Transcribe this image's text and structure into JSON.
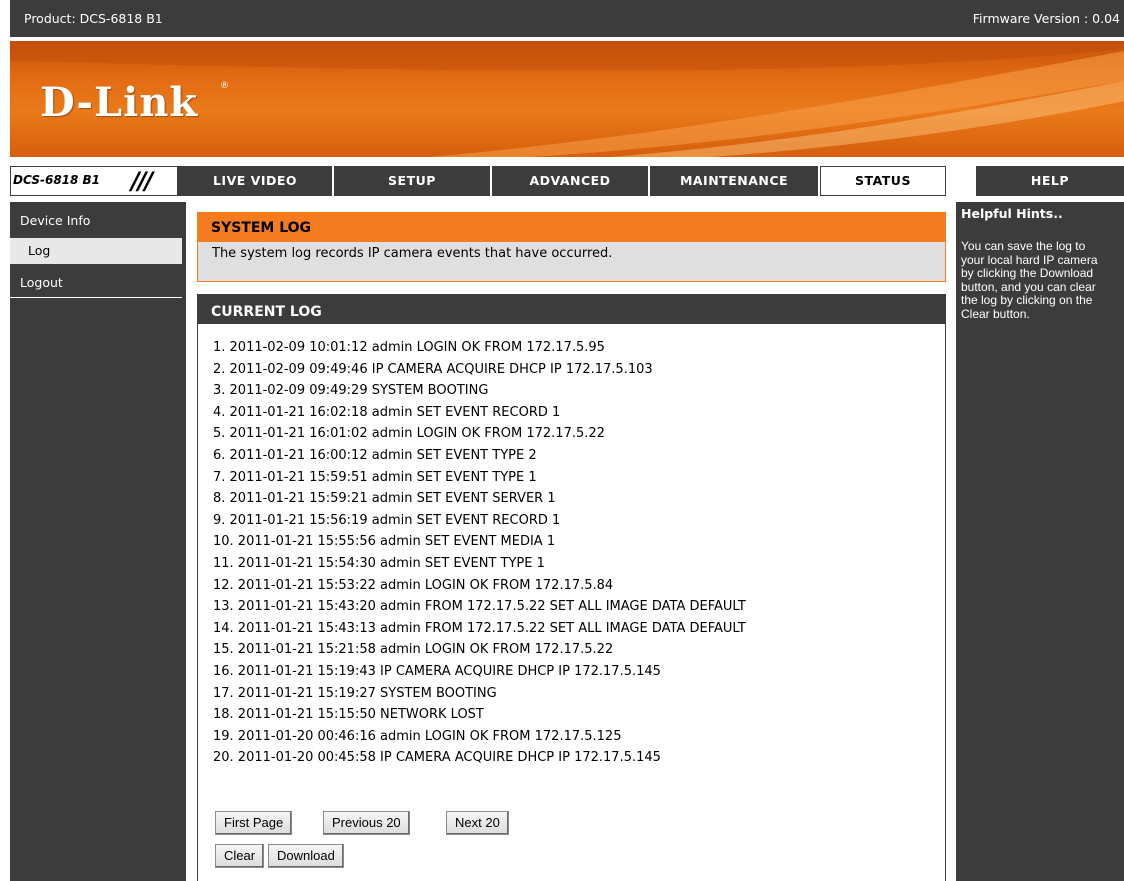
{
  "header": {
    "product": "Product: DCS-6818 B1",
    "firmware": "Firmware Version : 0.04"
  },
  "brand": {
    "logo_text": "D-Link",
    "registered_mark": "®",
    "accent_color": "#f47b20",
    "dark_color": "#3c3c3c"
  },
  "nav": {
    "model": "DCS-6818 B1",
    "slashes": "///",
    "tabs": [
      {
        "label": "LIVE VIDEO"
      },
      {
        "label": "SETUP"
      },
      {
        "label": "ADVANCED"
      },
      {
        "label": "MAINTENANCE"
      },
      {
        "label": "STATUS"
      },
      {
        "label": "HELP"
      }
    ],
    "active_tab": "STATUS"
  },
  "sidebar": {
    "items": [
      {
        "label": "Device Info"
      },
      {
        "label": "Log"
      },
      {
        "label": "Logout"
      }
    ],
    "active_item": "Log"
  },
  "system_log": {
    "title": "SYSTEM LOG",
    "description": "The system log records IP camera events that have occurred."
  },
  "current_log": {
    "title": "CURRENT LOG",
    "entries": [
      "1. 2011-02-09 10:01:12 admin LOGIN OK FROM 172.17.5.95",
      "2. 2011-02-09 09:49:46 IP CAMERA ACQUIRE DHCP IP 172.17.5.103",
      "3. 2011-02-09 09:49:29 SYSTEM BOOTING",
      "4. 2011-01-21 16:02:18 admin SET EVENT RECORD 1",
      "5. 2011-01-21 16:01:02 admin LOGIN OK FROM 172.17.5.22",
      "6. 2011-01-21 16:00:12 admin SET EVENT TYPE 2",
      "7. 2011-01-21 15:59:51 admin SET EVENT TYPE 1",
      "8. 2011-01-21 15:59:21 admin SET EVENT SERVER 1",
      "9. 2011-01-21 15:56:19 admin SET EVENT RECORD 1",
      "10. 2011-01-21 15:55:56 admin SET EVENT MEDIA 1",
      "11. 2011-01-21 15:54:30 admin SET EVENT TYPE 1",
      "12. 2011-01-21 15:53:22 admin LOGIN OK FROM 172.17.5.84",
      "13. 2011-01-21 15:43:20 admin FROM 172.17.5.22 SET ALL IMAGE DATA DEFAULT",
      "14. 2011-01-21 15:43:13 admin FROM 172.17.5.22 SET ALL IMAGE DATA DEFAULT",
      "15. 2011-01-21 15:21:58 admin LOGIN OK FROM 172.17.5.22",
      "16. 2011-01-21 15:19:43 IP CAMERA ACQUIRE DHCP IP 172.17.5.145",
      "17. 2011-01-21 15:19:27 SYSTEM BOOTING",
      "18. 2011-01-21 15:15:50 NETWORK LOST",
      "19. 2011-01-20 00:46:16 admin LOGIN OK FROM 172.17.5.125",
      "20. 2011-01-20 00:45:58 IP CAMERA ACQUIRE DHCP IP 172.17.5.145"
    ],
    "buttons": {
      "first_page": "First Page",
      "previous": "Previous 20",
      "next": "Next 20",
      "clear": "Clear",
      "download": "Download"
    }
  },
  "hints": {
    "title": "Helpful Hints..",
    "text": "You can save the log to\nyour local hard IP camera\nby clicking the Download\nbutton, and you can clear\nthe log by clicking on the\nClear button."
  }
}
